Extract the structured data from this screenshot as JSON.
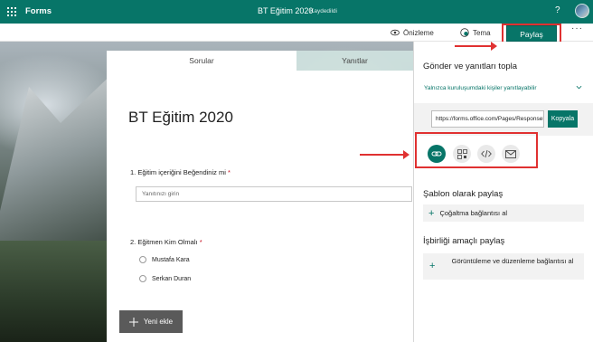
{
  "topbar": {
    "app_name": "Forms",
    "doc_title": "BT Eğitim 2020",
    "save_status": "Kaydedildi",
    "help": "?",
    "avatar_icon": "user-avatar"
  },
  "commandbar": {
    "preview_label": "Önizleme",
    "theme_label": "Tema",
    "share_label": "Paylaş",
    "more_label": "···"
  },
  "tabs": {
    "questions": "Sorular",
    "responses": "Yanıtlar"
  },
  "form": {
    "title": "BT Eğitim 2020",
    "q1_label": "1. Eğitim içeriğini Beğendiniz mi",
    "q1_required": "*",
    "q1_placeholder": "Yanıtınızı girin",
    "q2_label": "2. Eğitmen Kim Olmalı",
    "q2_required": "*",
    "q2_options": [
      "Mustafa Kara",
      "Serkan Duran"
    ],
    "add_new_label": "Yeni ekle"
  },
  "share_panel": {
    "heading": "Gönder ve yanıtları topla",
    "audience_option": "Yalnızca kuruluşumdaki kişiler yanıtlayabilir",
    "url_value": "https://forms.office.com/Pages/ResponsePage.aspx",
    "copy_label": "Kopyala",
    "template_heading": "Şablon olarak paylaş",
    "duplicate_link_label": "Çoğaltma bağlantısı al",
    "collab_heading": "İşbirliği amaçlı paylaş",
    "collab_link_label": "Görüntüleme ve düzenleme bağlantısı al",
    "share_methods": [
      "link-icon",
      "qr-code-icon",
      "embed-icon",
      "email-icon"
    ]
  },
  "colors": {
    "brand": "#077568",
    "highlight": "#e03131"
  }
}
